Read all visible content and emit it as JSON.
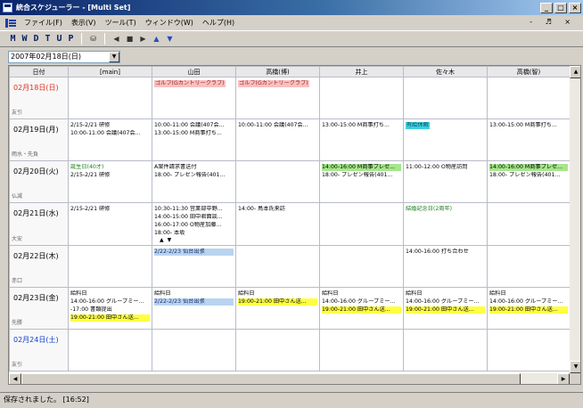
{
  "window": {
    "title": "統合スケジューラー - [Multi Set]",
    "min": "_",
    "max": "□",
    "close": "×"
  },
  "menu": [
    "ファイル(F)",
    "表示(V)",
    "ツール(T)",
    "ウィンドウ(W)",
    "ヘルプ(H)"
  ],
  "mdi_controls": "- ♬ ×",
  "toolbar": {
    "views": [
      "M",
      "W",
      "D",
      "T",
      "U",
      "P"
    ]
  },
  "date_select": "2007年02月18日(日)",
  "columns": [
    "日付",
    "[main]",
    "山田",
    "高橋(博)",
    "井上",
    "佐々木",
    "高橋(智)"
  ],
  "rows": [
    {
      "date": "02月18日(日)",
      "kind": "sun",
      "rokuyo": "友引",
      "cells": [
        [],
        [
          {
            "t": "ゴルフ(Gカントリークラブ)",
            "c": "pink"
          }
        ],
        [
          {
            "t": "ゴルフ(Gカントリークラブ)",
            "c": "pink"
          }
        ],
        [],
        [],
        []
      ]
    },
    {
      "date": "02月19日(月)",
      "kind": "",
      "rokuyo": "雨水・先負",
      "cells": [
        [
          {
            "t": "2/15-2/21 研修"
          },
          {
            "t": "10:00-11:00 会議(407会..."
          }
        ],
        [
          {
            "t": "10:00-11:00 会議(407会..."
          },
          {
            "t": "13:00-15:00 M商事打ち..."
          }
        ],
        [
          {
            "t": "10:00-11:00 会議(407会..."
          }
        ],
        [
          {
            "t": "13:00-15:00 M商事打ち..."
          }
        ],
        [
          {
            "t": "有給休暇",
            "c": "cyan"
          }
        ],
        [
          {
            "t": "13:00-15:00 M商事打ち..."
          }
        ]
      ]
    },
    {
      "date": "02月20日(火)",
      "kind": "",
      "rokuyo": "仏滅",
      "cells": [
        [
          {
            "t": "誕生日(40才)",
            "c": "gtxt"
          },
          {
            "t": "2/15-2/21 研修"
          }
        ],
        [
          {
            "t": "A案件請求書送付"
          },
          {
            "t": "18:00- プレゼン報告(401..."
          }
        ],
        [],
        [
          {
            "t": "14:00-16:00 M商事プレゼ...",
            "c": "green"
          },
          {
            "t": "18:00- プレゼン報告(401..."
          }
        ],
        [
          {
            "t": "11:00-12:00 O物産訪問"
          }
        ],
        [
          {
            "t": "14:00-16:00 M商事プレゼ...",
            "c": "green"
          },
          {
            "t": "18:00- プレゼン報告(401..."
          }
        ]
      ]
    },
    {
      "date": "02月21日(水)",
      "kind": "",
      "rokuyo": "大安",
      "cells": [
        [
          {
            "t": "2/15-2/21 研修"
          }
        ],
        [
          {
            "t": "10:30-11:30 営業部中野..."
          },
          {
            "t": "14:00-15:00 田中君面談..."
          },
          {
            "t": "16:00-17:00 O物産加藤..."
          },
          {
            "t": "18:00- 本坂"
          }
        ],
        [
          {
            "t": "14:00- 鳥本氏来訪"
          }
        ],
        [],
        [
          {
            "t": "結婚記念日(2周年)",
            "c": "gtxt"
          }
        ],
        []
      ]
    },
    {
      "date": "02月22日(木)",
      "kind": "",
      "rokuyo": "赤口",
      "cells": [
        [],
        [
          {
            "t": "2/22-2/23 仙台出張",
            "c": "blue"
          }
        ],
        [],
        [],
        [
          {
            "t": "14:00-16:00 打ち合わせ"
          }
        ],
        []
      ]
    },
    {
      "date": "02月23日(金)",
      "kind": "",
      "rokuyo": "先勝",
      "cells": [
        [
          {
            "t": "給料日"
          },
          {
            "t": "14:00-16:00 グループミー..."
          },
          {
            "t": "-17:00 書類提出"
          },
          {
            "t": "19:00-21:00 田中さん送...",
            "c": "yellow"
          }
        ],
        [
          {
            "t": "給料日"
          },
          {
            "t": "2/22-2/23 仙台出張",
            "c": "blue"
          }
        ],
        [
          {
            "t": "給料日"
          },
          {
            "t": "19:00-21:00 田中さん送...",
            "c": "yellow"
          }
        ],
        [
          {
            "t": "給料日"
          },
          {
            "t": "14:00-16:00 グループミー..."
          },
          {
            "t": "19:00-21:00 田中さん送...",
            "c": "yellow"
          }
        ],
        [
          {
            "t": "給料日"
          },
          {
            "t": "14:00-16:00 グループミー..."
          },
          {
            "t": "19:00-21:00 田中さん送...",
            "c": "yellow"
          }
        ],
        [
          {
            "t": "給料日"
          },
          {
            "t": "14:00-16:00 グループミー..."
          },
          {
            "t": "19:00-21:00 田中さん送...",
            "c": "yellow"
          }
        ]
      ]
    },
    {
      "date": "02月24日(土)",
      "kind": "sat",
      "rokuyo": "友引",
      "cells": [
        [],
        [],
        [],
        [],
        [],
        []
      ]
    }
  ],
  "status": "保存されました。 [16:52]"
}
